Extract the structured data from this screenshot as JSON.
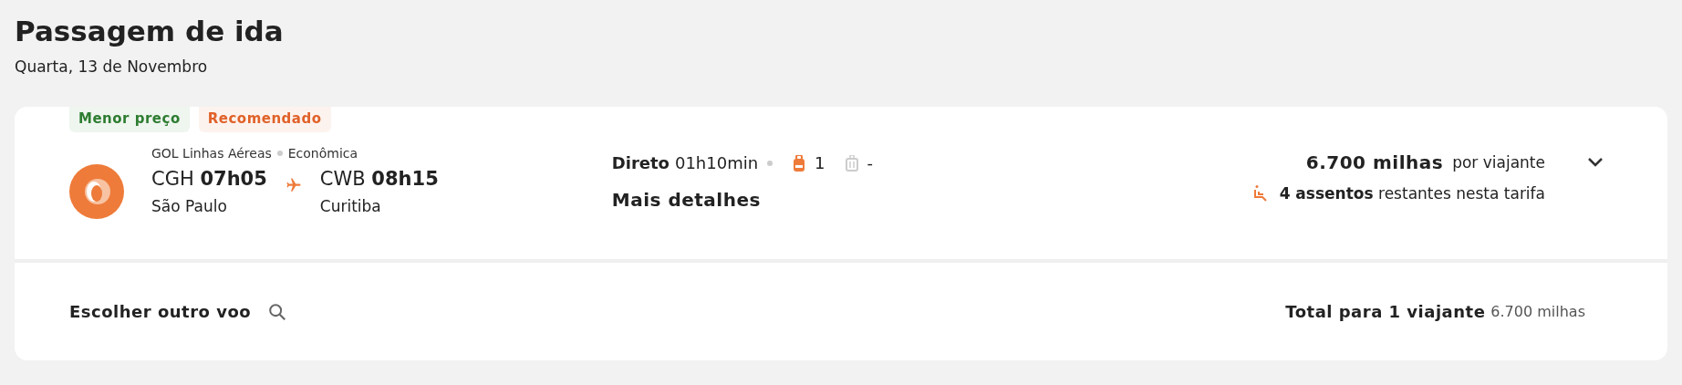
{
  "header": {
    "title": "Passagem de ida",
    "date": "Quarta, 13 de Novembro"
  },
  "flight": {
    "tags": [
      {
        "label": "Menor preço",
        "color": "#2e7d32"
      },
      {
        "label": "Recomendado",
        "color": "#e0622a"
      }
    ],
    "airline": "GOL Linhas Aéreas",
    "cabin": "Econômica",
    "departure": {
      "code": "CGH",
      "time": "07h05",
      "city": "São Paulo"
    },
    "arrival": {
      "code": "CWB",
      "time": "08h15",
      "city": "Curitiba"
    },
    "stops": "Direto",
    "duration": "01h10min",
    "baggage": [
      {
        "kind": "backpack",
        "count": "1",
        "included": true
      },
      {
        "kind": "suitcase",
        "count": "-",
        "included": false
      }
    ],
    "details_link": "Mais detalhes",
    "price": "6.700 milhas",
    "price_unit": "por viajante",
    "expanded": false,
    "seats": "**4 assentos** restantes nesta tarifa"
  },
  "footer": {
    "change_link": "Escolher outro voo",
    "total_label": "Total para 1 viajante",
    "total_value": "6.700 milhas"
  }
}
